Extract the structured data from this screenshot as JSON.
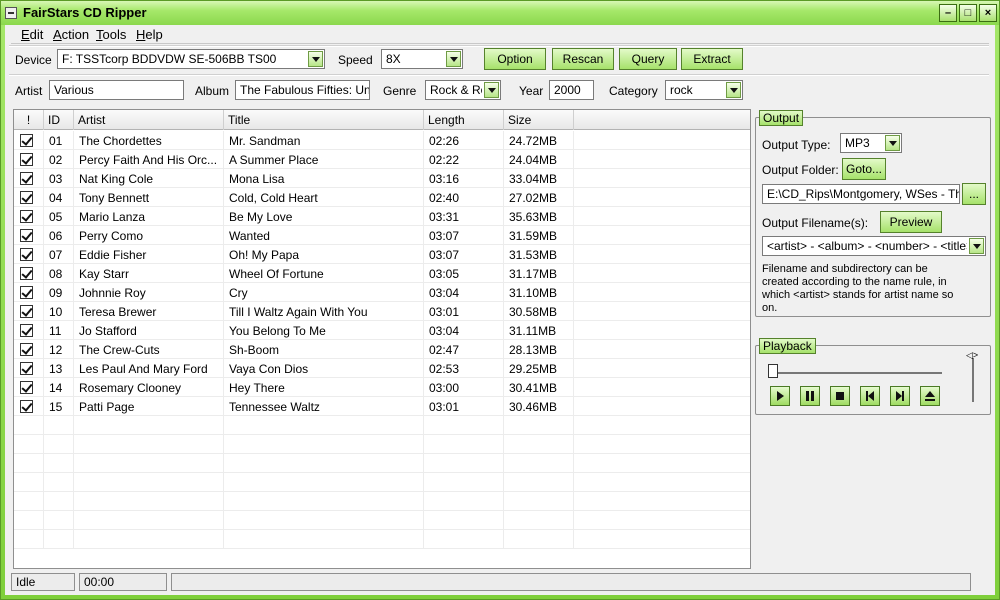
{
  "window": {
    "title": "FairStars CD Ripper"
  },
  "menu": [
    "Edit",
    "Action",
    "Tools",
    "Help"
  ],
  "device_bar": {
    "device_label": "Device",
    "device_value": "F: TSSTcorp BDDVDW SE-506BB TS00",
    "speed_label": "Speed",
    "speed_value": "8X",
    "buttons": [
      "Option",
      "Rescan",
      "Query",
      "Extract"
    ]
  },
  "album_bar": {
    "artist_label": "Artist",
    "artist_value": "Various",
    "album_label": "Album",
    "album_value": "The Fabulous Fifties: Unfo",
    "genre_label": "Genre",
    "genre_value": "Rock & Rol",
    "year_label": "Year",
    "year_value": "2000",
    "category_label": "Category",
    "category_value": "rock"
  },
  "tracklist": {
    "columns": [
      "!",
      "ID",
      "Artist",
      "Title",
      "Length",
      "Size"
    ],
    "rows": [
      {
        "id": "01",
        "artist": "The Chordettes",
        "title": "Mr. Sandman",
        "length": "02:26",
        "size": "24.72MB"
      },
      {
        "id": "02",
        "artist": "Percy Faith And His Orc...",
        "title": "A Summer Place",
        "length": "02:22",
        "size": "24.04MB"
      },
      {
        "id": "03",
        "artist": "Nat King Cole",
        "title": "Mona Lisa",
        "length": "03:16",
        "size": "33.04MB"
      },
      {
        "id": "04",
        "artist": "Tony Bennett",
        "title": "Cold, Cold Heart",
        "length": "02:40",
        "size": "27.02MB"
      },
      {
        "id": "05",
        "artist": "Mario Lanza",
        "title": "Be My Love",
        "length": "03:31",
        "size": "35.63MB"
      },
      {
        "id": "06",
        "artist": "Perry Como",
        "title": "Wanted",
        "length": "03:07",
        "size": "31.59MB"
      },
      {
        "id": "07",
        "artist": "Eddie Fisher",
        "title": "Oh! My Papa",
        "length": "03:07",
        "size": "31.53MB"
      },
      {
        "id": "08",
        "artist": "Kay Starr",
        "title": "Wheel Of Fortune",
        "length": "03:05",
        "size": "31.17MB"
      },
      {
        "id": "09",
        "artist": "Johnnie Roy",
        "title": "Cry",
        "length": "03:04",
        "size": "31.10MB"
      },
      {
        "id": "10",
        "artist": "Teresa Brewer",
        "title": "Till I Waltz Again With You",
        "length": "03:01",
        "size": "30.58MB"
      },
      {
        "id": "11",
        "artist": "Jo Stafford",
        "title": "You Belong To Me",
        "length": "03:04",
        "size": "31.11MB"
      },
      {
        "id": "12",
        "artist": "The Crew-Cuts",
        "title": "Sh-Boom",
        "length": "02:47",
        "size": "28.13MB"
      },
      {
        "id": "13",
        "artist": "Les Paul And Mary Ford",
        "title": "Vaya Con Dios",
        "length": "02:53",
        "size": "29.25MB"
      },
      {
        "id": "14",
        "artist": "Rosemary Clooney",
        "title": "Hey There",
        "length": "03:00",
        "size": "30.41MB"
      },
      {
        "id": "15",
        "artist": "Patti Page",
        "title": "Tennessee Waltz",
        "length": "03:01",
        "size": "30.46MB"
      }
    ]
  },
  "output": {
    "title": "Output",
    "type_label": "Output Type:",
    "type_value": "MP3",
    "folder_label": "Output Folder:",
    "goto_label": "Goto...",
    "folder_value": "E:\\CD_Rips\\Montgomery, WSes - The I",
    "browse_label": "...",
    "filename_label": "Output Filename(s):",
    "preview_label": "Preview",
    "filename_value": "<artist> - <album> - <number> - <title>",
    "hint": "Filename and subdirectory can be created according to the name rule, in which <artist> stands for artist name so on."
  },
  "playback": {
    "title": "Playback",
    "volume_glyph": "◁>"
  },
  "status": {
    "state": "Idle",
    "time": "00:00"
  },
  "colors": {
    "accent_green": "#a6e26b",
    "frame_green": "#7fcf3b"
  }
}
